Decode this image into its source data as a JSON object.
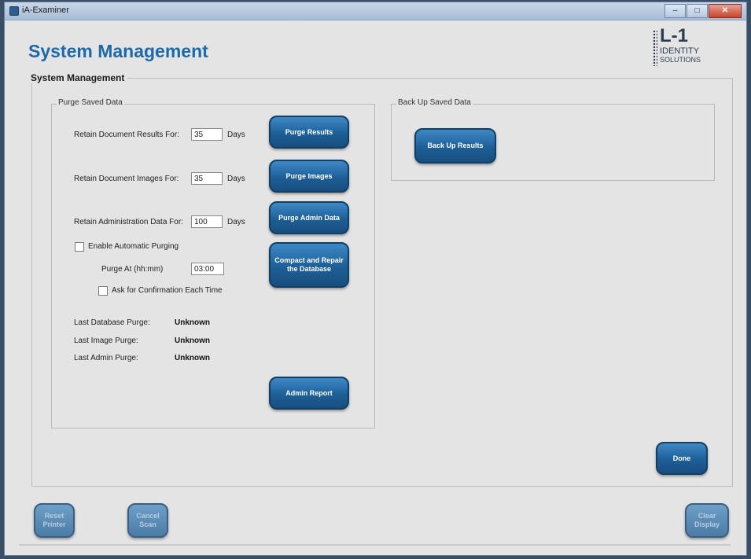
{
  "window": {
    "title": "iA-Examiner",
    "minimize": "–",
    "maximize": "□",
    "close": "✕"
  },
  "header": {
    "title": "System Management"
  },
  "logo": {
    "main": "L-1",
    "sub1": "IDENTITY",
    "sub2": "SOLUTIONS"
  },
  "section_title": "System Management",
  "purge": {
    "title": "Purge Saved Data",
    "doc_results_label": "Retain Document Results For:",
    "doc_results_value": "35",
    "doc_images_label": "Retain Document Images For:",
    "doc_images_value": "35",
    "admin_data_label": "Retain Administration Data For:",
    "admin_data_value": "100",
    "days": "Days",
    "enable_auto": "Enable Automatic Purging",
    "purge_at_label": "Purge At (hh:mm)",
    "purge_at_value": "03:00",
    "ask_confirm": "Ask for Confirmation Each Time",
    "last_db_label": "Last Database Purge:",
    "last_db_value": "Unknown",
    "last_image_label": "Last Image Purge:",
    "last_image_value": "Unknown",
    "last_admin_label": "Last Admin Purge:",
    "last_admin_value": "Unknown",
    "purge_results_btn": "Purge Results",
    "purge_images_btn": "Purge Images",
    "purge_admin_btn": "Purge Admin Data",
    "compact_btn": "Compact and Repair the Database",
    "admin_report_btn": "Admin Report"
  },
  "backup": {
    "title": "Back Up Saved Data",
    "btn": "Back Up Results"
  },
  "done_btn": "Done",
  "bottom": {
    "reset_btn": "Reset Printer",
    "cancel_btn": "Cancel Scan",
    "clear_btn": "Clear Display"
  }
}
